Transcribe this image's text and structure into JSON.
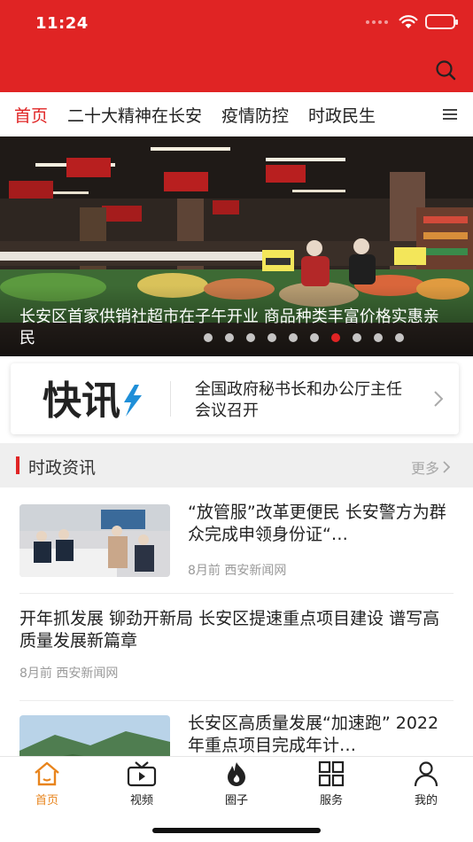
{
  "status": {
    "time": "11:24"
  },
  "colors": {
    "brand_red": "#e02424",
    "tab_active_orange": "#e8841c"
  },
  "header": {
    "search_icon": "search-icon"
  },
  "tabs": [
    {
      "label": "首页",
      "active": true
    },
    {
      "label": "二十大精神在长安",
      "active": false
    },
    {
      "label": "疫情防控",
      "active": false
    },
    {
      "label": "时政民生",
      "active": false
    }
  ],
  "tabs_more_icon": "menu-icon",
  "banner": {
    "caption": "长安区首家供销社超市在子午开业 商品种类丰富价格实惠亲民",
    "slide_count": 10,
    "active_slide": 6
  },
  "flash": {
    "logo_text": "快讯",
    "headline": "全国政府秘书长和办公厅主任会议召开"
  },
  "section": {
    "title": "时政资讯",
    "more": "更多"
  },
  "news": [
    {
      "title": "“放管服”改革更便民 长安警方为群众完成申领身份证“…",
      "time": "8月前",
      "source": "西安新闻网"
    },
    {
      "title": "开年抓发展 铆劲开新局 长安区提速重点项目建设 谱写高质量发展新篇章",
      "time": "8月前",
      "source": "西安新闻网"
    },
    {
      "title": "长安区高质量发展“加速跑” 2022年重点项目完成年计…",
      "time": "",
      "source": ""
    }
  ],
  "tabbar": [
    {
      "label": "首页",
      "icon": "home-icon",
      "active": true
    },
    {
      "label": "视频",
      "icon": "video-icon",
      "active": false
    },
    {
      "label": "圈子",
      "icon": "flame-icon",
      "active": false
    },
    {
      "label": "服务",
      "icon": "grid-icon",
      "active": false
    },
    {
      "label": "我的",
      "icon": "user-icon",
      "active": false
    }
  ]
}
